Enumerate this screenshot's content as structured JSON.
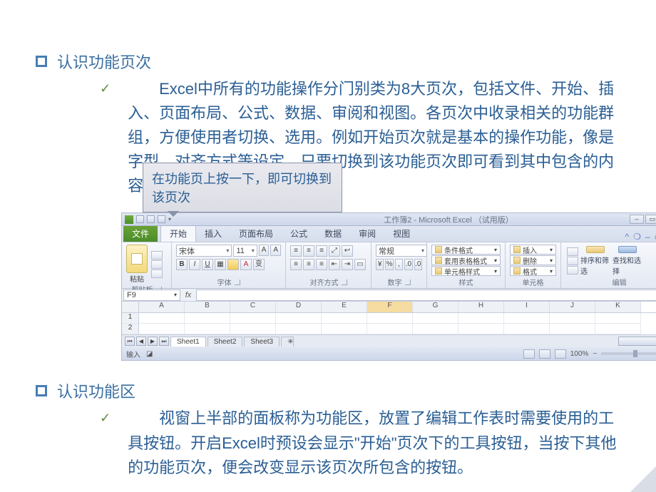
{
  "section1": {
    "title": "认识功能页次",
    "paragraph": "Excel中所有的功能操作分门别类为8大页次，包括文件、开始、插入、页面布局、公式、数据、审阅和视图。各页次中收录相关的功能群组，方便使用者切换、选用。例如开始页次就是基本的操作功能，像是字型、对齐方式等设定，只要切换到该功能页次即可看到其中包含的内容。",
    "callout": "在功能页上按一下，即可切换到该页次"
  },
  "section2": {
    "title": "认识功能区",
    "paragraph": "视窗上半部的面板称为功能区，放置了编辑工作表时需要使用的工具按钮。开启Excel时预设会显示\"开始\"页次下的工具按钮，当按下其他的功能页次，便会改变显示该页次所包含的按钮。"
  },
  "excel": {
    "title_center": "工作簿2 - Microsoft Excel （试用版）",
    "file_tab": "文件",
    "tabs": [
      "开始",
      "插入",
      "页面布局",
      "公式",
      "数据",
      "审阅",
      "视图"
    ],
    "paste_label": "粘贴",
    "groups": {
      "clipboard": "剪贴板",
      "font": "字体",
      "align": "对齐方式",
      "number": "数字",
      "style": "样式",
      "cells": "单元格",
      "editing": "编辑"
    },
    "font_name": "宋体",
    "font_size": "11",
    "number_format": "常规",
    "style_items": [
      "条件格式",
      "套用表格格式",
      "单元格样式"
    ],
    "cells_items": [
      "插入",
      "删除",
      "格式"
    ],
    "edit_sort": "排序和筛选",
    "edit_find": "查找和选择",
    "name_box": "F9",
    "columns": [
      "A",
      "B",
      "C",
      "D",
      "E",
      "F",
      "G",
      "H",
      "I",
      "J",
      "K"
    ],
    "rows": [
      "1",
      "2"
    ],
    "active_col": "F",
    "sheets": [
      "Sheet1",
      "Sheet2",
      "Sheet3"
    ],
    "status_left": "输入",
    "zoom": "100%"
  }
}
